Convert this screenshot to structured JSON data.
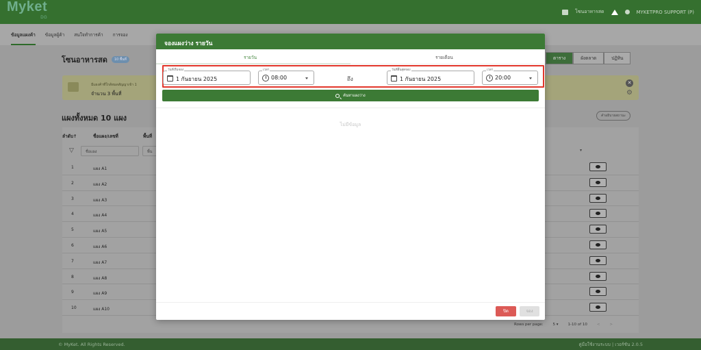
{
  "app": {
    "logo": "Myket",
    "logo_sub": "DG",
    "zone_link": "โซนอาหารสด",
    "user": "MYKETPRO SUPPORT (P)"
  },
  "nav": {
    "items": [
      "ข้อมูลแผงค้า",
      "ข้อมูลผู้ค้า",
      "สนใจทำการค้า",
      "การจอง"
    ]
  },
  "page": {
    "zone_title": "โซนอาหารสด",
    "zone_badge": "10 พื้นที่",
    "view_tabs": [
      "ตาราง",
      "ผังตลาด",
      "ปฏิทิน"
    ],
    "notice_line1": "มีแผงค้าที่ใกล้หมดสัญญาเข้า 1",
    "notice_line2": "จำนวน 3 พื้นที่",
    "total": "แผงทั้งหมด 10 แผง",
    "explain": "คำอธิบายสถานะ"
  },
  "table": {
    "headers": {
      "order": "ลำดับ↑",
      "stall_name": "ชื่อแผง/เลขที่",
      "area": "พื้นที่"
    },
    "filters": {
      "name": "ชื่อแผง",
      "area": "พื้น"
    },
    "rows": [
      {
        "num": "1",
        "name": "แผง A1"
      },
      {
        "num": "2",
        "name": "แผง A2"
      },
      {
        "num": "3",
        "name": "แผง A3"
      },
      {
        "num": "4",
        "name": "แผง A4"
      },
      {
        "num": "5",
        "name": "แผง A5"
      },
      {
        "num": "6",
        "name": "แผง A6"
      },
      {
        "num": "7",
        "name": "แผง A7"
      },
      {
        "num": "8",
        "name": "แผง A8"
      },
      {
        "num": "9",
        "name": "แผง A9"
      },
      {
        "num": "10",
        "name": "แผง A10"
      }
    ],
    "pagination": {
      "rows_label": "Rows per page:",
      "rows_value": "5",
      "range": "1-10 of 10",
      "prev": "<",
      "next": ">"
    }
  },
  "footer": {
    "copyright": "© MyKet. All Rights Reserved.",
    "version": "คู่มือใช้งานระบบ | เวอร์ชัน 2.0.5"
  },
  "modal": {
    "title": "จองแผงว่าง รายวัน",
    "tabs": [
      "รายวัน",
      "รายเดือน"
    ],
    "start_date": {
      "label": "วันที่เริ่มจอง",
      "value": "1 กันยายน 2025"
    },
    "start_time": {
      "label": "เวลา",
      "value": "08:00"
    },
    "to_label": "ถึง",
    "end_date": {
      "label": "วันที่สิ้นสุดจอง",
      "value": "1 กันยายน 2025"
    },
    "end_time": {
      "label": "เวลา",
      "value": "20:00"
    },
    "search_label": "ค้นหาแผงว่าง",
    "no_data": "ไม่มีข้อมูล",
    "close_label": "ปิด",
    "book_label": "จอง"
  },
  "colors": {
    "brand_green": "#3c7a35",
    "highlight_red": "#e2352a",
    "close_red": "#dc5a56"
  }
}
